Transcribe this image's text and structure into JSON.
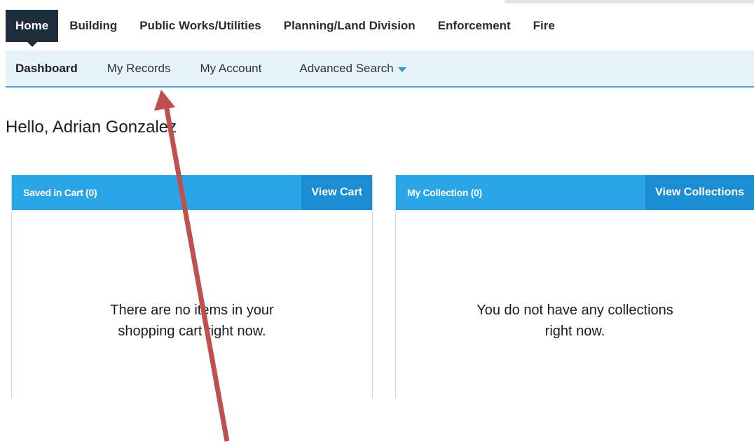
{
  "main_nav": {
    "tabs": [
      {
        "label": "Home",
        "active": true
      },
      {
        "label": "Building"
      },
      {
        "label": "Public Works/Utilities"
      },
      {
        "label": "Planning/Land Division"
      },
      {
        "label": "Enforcement"
      },
      {
        "label": "Fire"
      }
    ]
  },
  "sub_nav": {
    "tabs": [
      {
        "label": "Dashboard",
        "active": true
      },
      {
        "label": "My Records"
      },
      {
        "label": "My Account"
      },
      {
        "label": "Advanced Search",
        "icon": "caret-down-icon"
      }
    ]
  },
  "greeting": "Hello, Adrian Gonzalez",
  "cart_panel": {
    "title": "Saved in Cart (0)",
    "button_label": "View Cart",
    "empty_message": "There are no items in your shopping cart right now."
  },
  "collection_panel": {
    "title": "My Collection (0)",
    "button_label": "View Collections",
    "empty_message": "You do not have any collections right now."
  },
  "colors": {
    "nav_active_bg": "#1e2d3b",
    "sub_nav_bg": "#e7f3fa",
    "panel_header": "#2aa6e6",
    "panel_button": "#1b8ed3",
    "annotation_arrow": "#c0504d"
  },
  "annotation": {
    "icon": "arrow-pointer-icon",
    "points_to": "My Records"
  }
}
